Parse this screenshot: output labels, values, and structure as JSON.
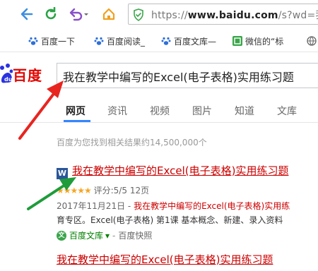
{
  "browser": {
    "url_prefix": "https://",
    "url_domain": "www.baidu.com",
    "url_rest": "/s?wd=我",
    "colors": {
      "nav_blue": "#3d8fe0",
      "refresh_green": "#2aa345",
      "undo_purple": "#8a4fc9",
      "home_orange": "#f0a020"
    }
  },
  "bookmarks": [
    {
      "label": "百度一下",
      "icon": "baidu-paw-icon"
    },
    {
      "label": "百度阅读_",
      "icon": "baidu-paw-icon"
    },
    {
      "label": "百度文库—",
      "icon": "baidu-paw-icon"
    },
    {
      "label": "微信的“标",
      "icon": "wechat-icon"
    }
  ],
  "baidu": {
    "logo_text": "百度",
    "query": "我在教学中编写的Excel(电子表格)实用练习题"
  },
  "tabs": [
    {
      "label": "网页",
      "active": true
    },
    {
      "label": "资讯"
    },
    {
      "label": "视频"
    },
    {
      "label": "图片"
    },
    {
      "label": "知道"
    },
    {
      "label": "文库"
    }
  ],
  "results_count": "百度为您找到相关结果约14,500,000个",
  "result1": {
    "doc_icon": "W",
    "title": "我在教学中编写的Excel(电子表格)实用练习题",
    "stars": "★★★★★",
    "rating": "评分:5/5",
    "pages": "12页",
    "date": "2017年11月21日 -",
    "snippet1": "我在教学中编写的Excel(电子表格)实用练",
    "snippet2": "育专区。Excel(电子表格) 第1课 基本概念、新建、录入资料",
    "source": "百度文库",
    "source_arrow": "▾",
    "sep": "-",
    "cache": "百度快照"
  },
  "result2": {
    "title": "我在教学中编写的Excel(电子表格)实用练习题"
  }
}
